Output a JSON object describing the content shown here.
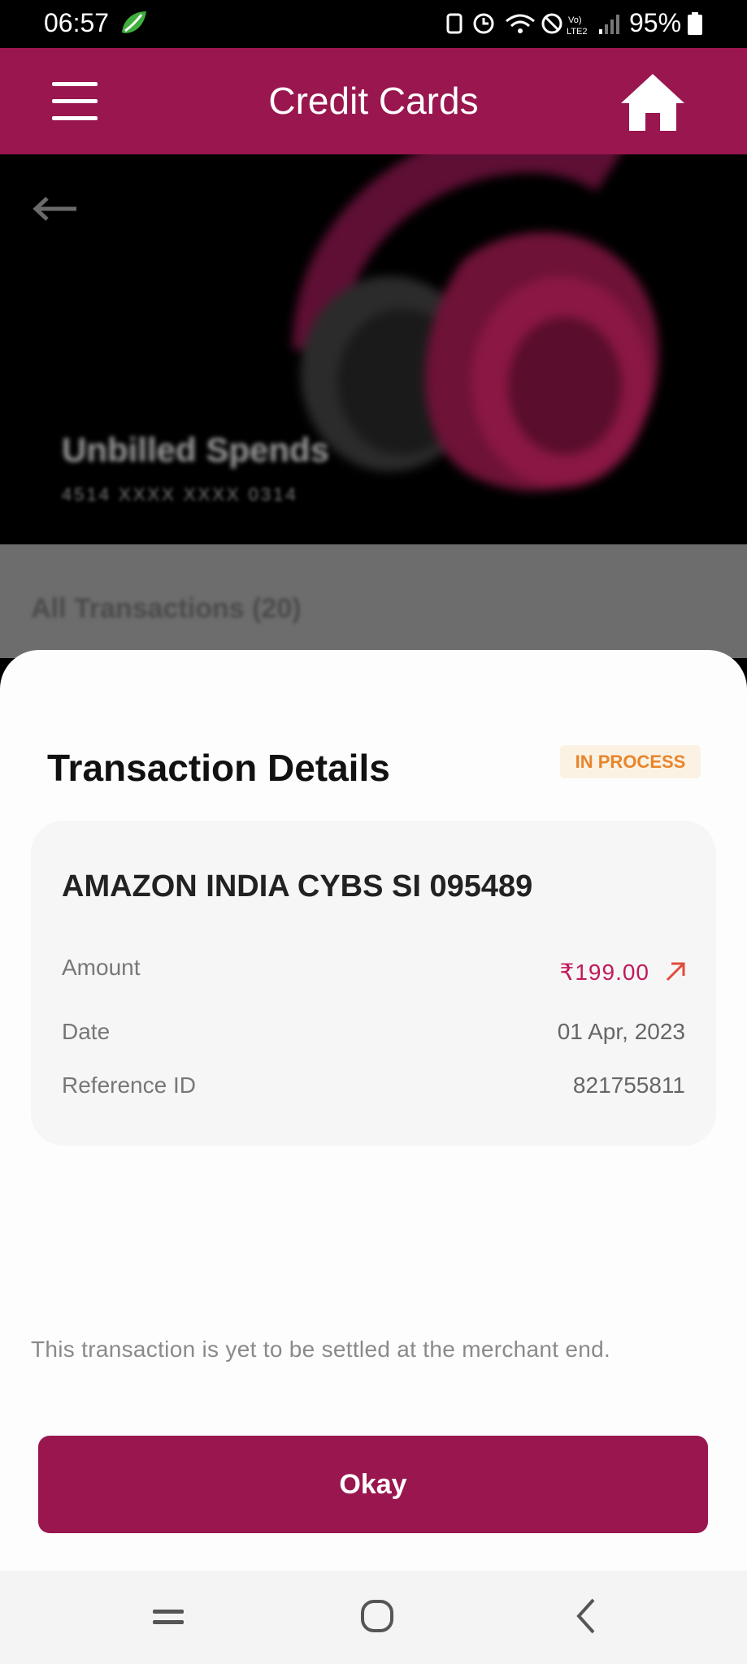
{
  "status_bar": {
    "time": "06:57",
    "battery": "95%"
  },
  "app_bar": {
    "title": "Credit Cards"
  },
  "hero": {
    "title": "Unbilled Spends",
    "card_number": "4514 XXXX XXXX 0314"
  },
  "list": {
    "heading": "All Transactions (20)"
  },
  "sheet": {
    "title": "Transaction Details",
    "status": "IN PROCESS",
    "merchant": "AMAZON INDIA CYBS SI 095489",
    "rows": [
      {
        "label": "Amount",
        "value": "₹199.00"
      },
      {
        "label": "Date",
        "value": "01 Apr, 2023"
      },
      {
        "label": "Reference ID",
        "value": "821755811"
      }
    ],
    "note": "This transaction is yet to be settled at the merchant end.",
    "button_label": "Okay"
  },
  "colors": {
    "brand": "#9a164e",
    "status_pending": "#e8852c",
    "amount": "#c2185b"
  },
  "icons": {
    "menu": "hamburger-icon",
    "home": "home-icon",
    "back": "back-arrow-icon",
    "amount_direction": "arrow-up-right-icon"
  }
}
